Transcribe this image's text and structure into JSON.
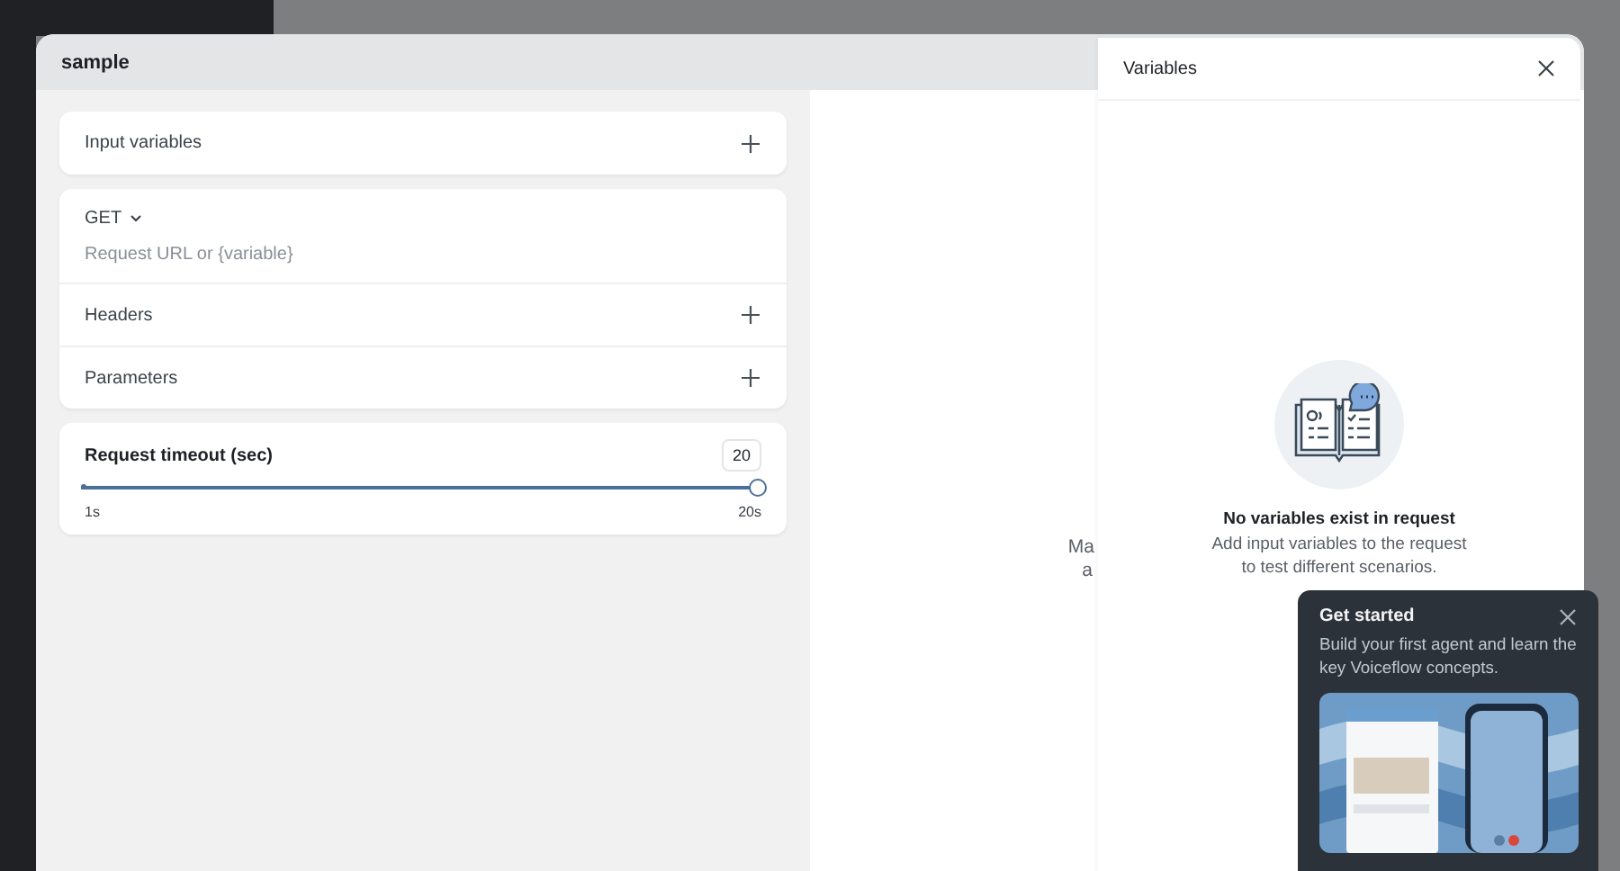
{
  "modal": {
    "title": "sample"
  },
  "input_variables": {
    "label": "Input variables"
  },
  "request": {
    "method": "GET",
    "url_placeholder": "Request URL or {variable}",
    "sections": [
      {
        "label": "Headers"
      },
      {
        "label": "Parameters"
      }
    ]
  },
  "timeout": {
    "label": "Request timeout (sec)",
    "value": "20",
    "level": 1,
    "min_label": "1s",
    "max_label": "20s"
  },
  "background_text": [
    "Ma",
    "a"
  ],
  "variables_panel": {
    "title": "Variables",
    "empty_title": "No variables exist in request",
    "empty_description": "Add input variables to the request to test different scenarios."
  },
  "get_started": {
    "title": "Get started",
    "description": "Build your first agent and learn the key Voiceflow concepts."
  }
}
